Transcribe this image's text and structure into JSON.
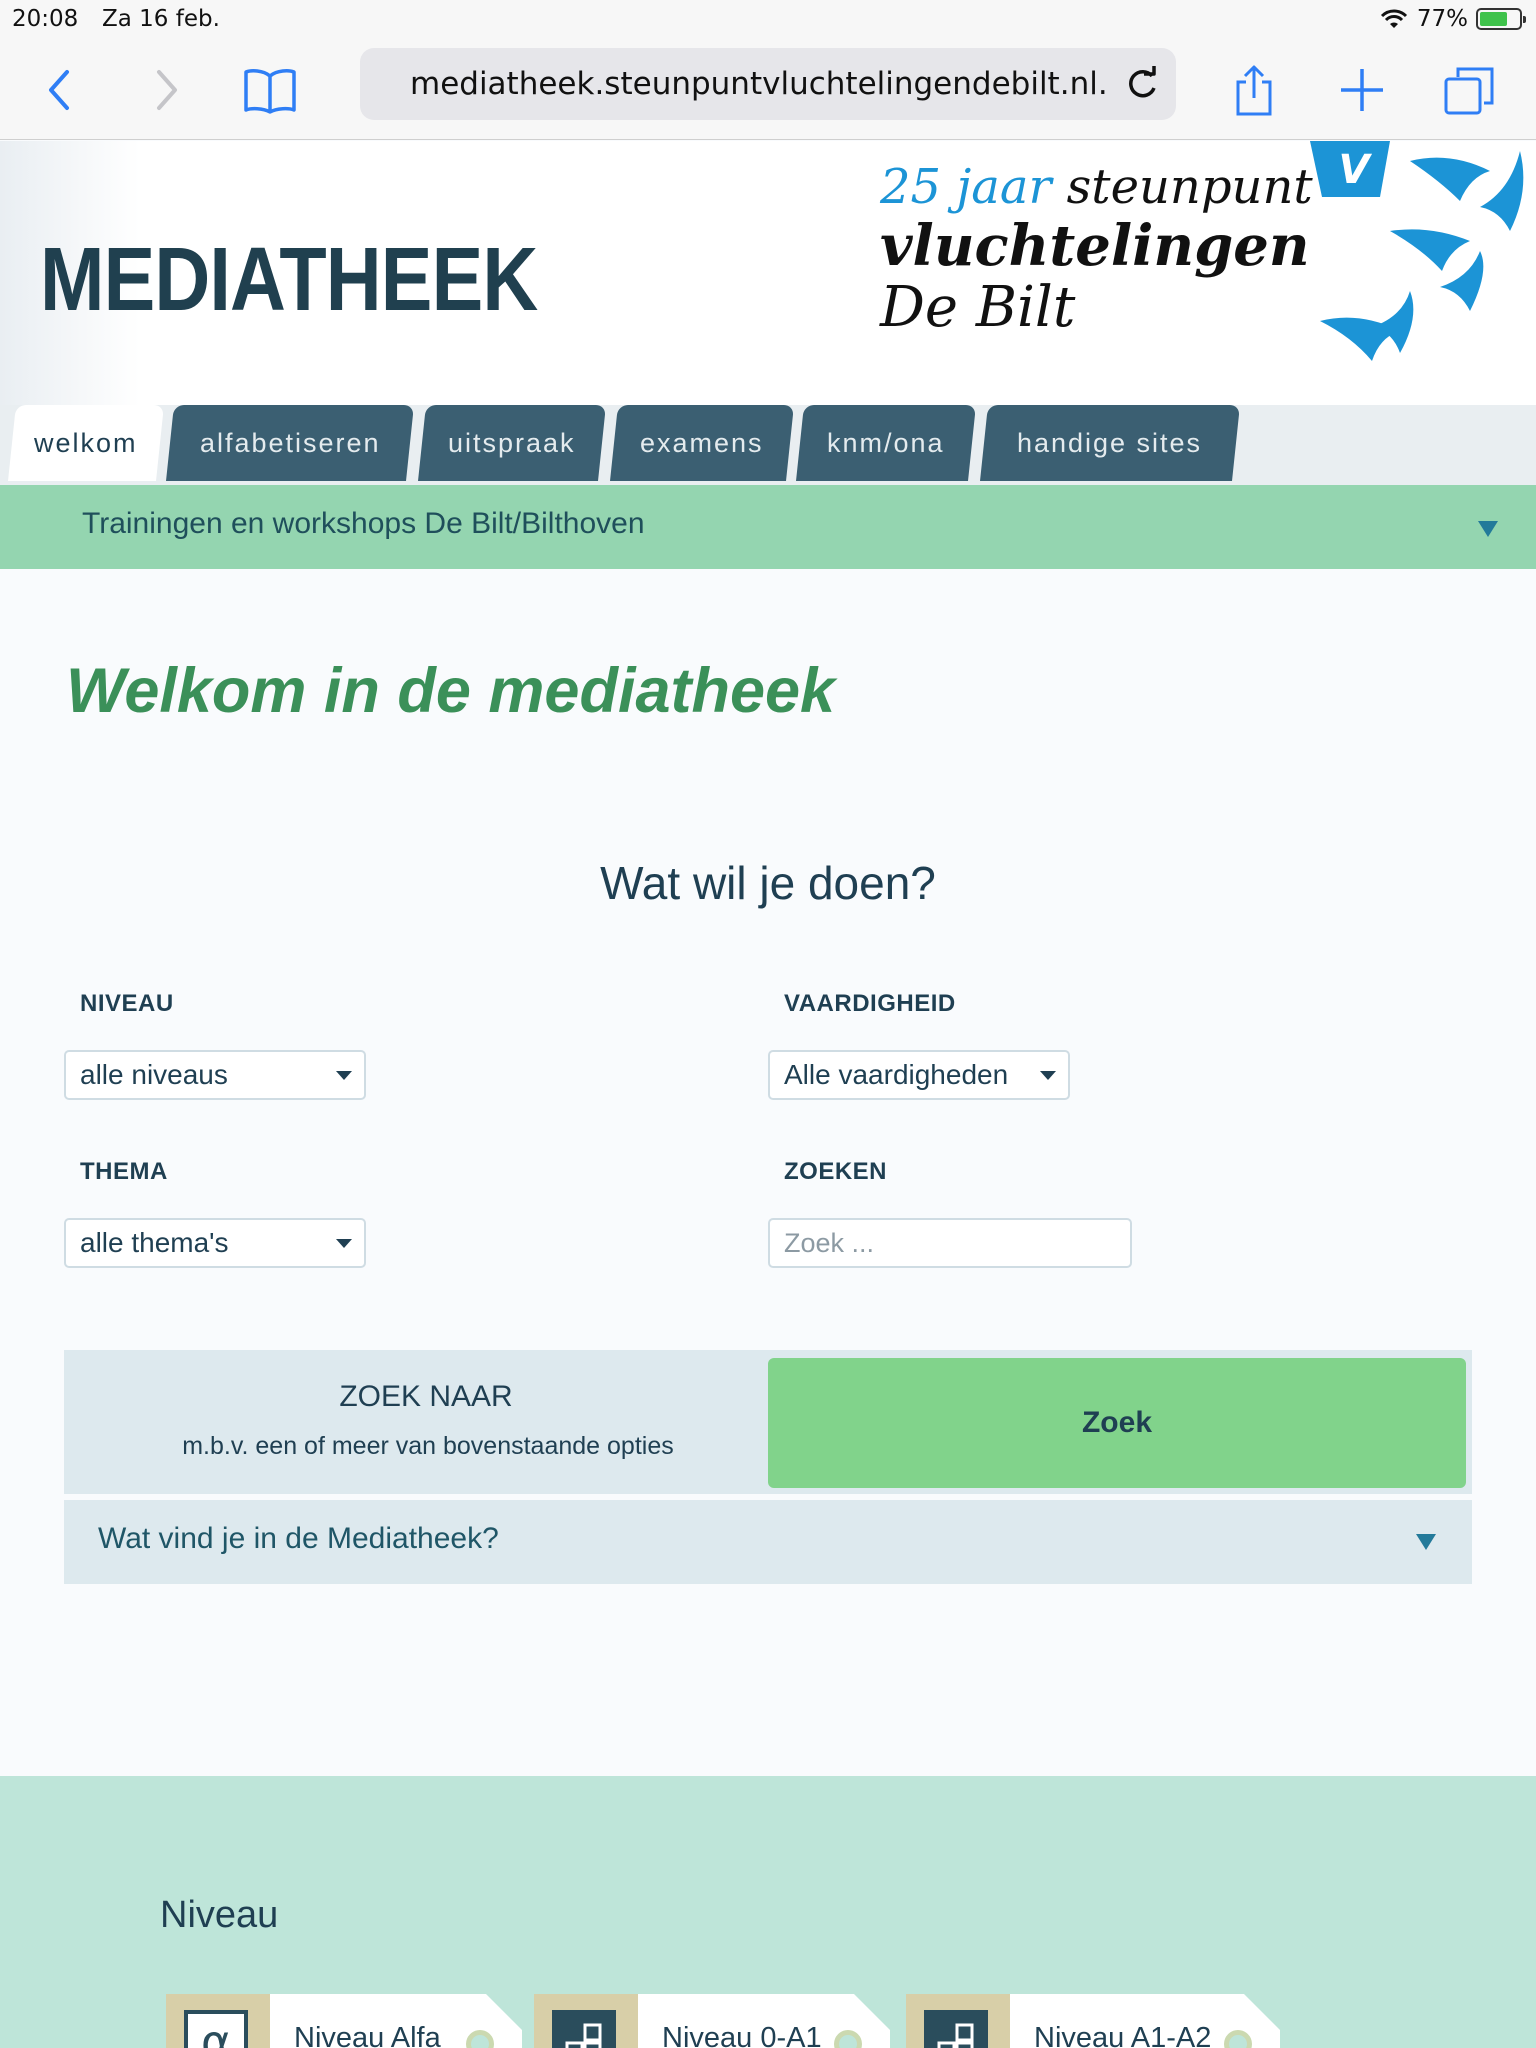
{
  "status_bar": {
    "time": "20:08",
    "date": "Za 16 feb.",
    "battery": "77%"
  },
  "browser": {
    "url": "mediatheek.steunpuntvluchtelingendebilt.nl."
  },
  "header": {
    "title": "MEDIATHEEK",
    "jubileum_l1_blue": "25 jaar",
    "jubileum_l1_rest": " steunpunt",
    "jubileum_l2": "vluchtelingen",
    "jubileum_l3": "De Bilt",
    "logo_letter": "V"
  },
  "tabs": [
    {
      "label": "welkom",
      "active": true
    },
    {
      "label": "alfabetiseren"
    },
    {
      "label": "uitspraak"
    },
    {
      "label": "examens"
    },
    {
      "label": "knm/ona"
    },
    {
      "label": "handige sites"
    }
  ],
  "banner": {
    "text": "Trainingen en workshops De Bilt/Bilthoven"
  },
  "main": {
    "welcome": "Welkom in de mediatheek",
    "question": "Wat wil je doen?",
    "niveau_label": "NIVEAU",
    "niveau_value": "alle niveaus",
    "vaardigheid_label": "VAARDIGHEID",
    "vaardigheid_value": "Alle vaardigheden",
    "thema_label": "THEMA",
    "thema_value": "alle thema's",
    "zoeken_label": "ZOEKEN",
    "zoeken_placeholder": "Zoek ...",
    "search_title": "ZOEK NAAR",
    "search_sub": "m.b.v. een of meer van bovenstaande opties",
    "search_button": "Zoek",
    "info_toggle": "Wat vind je in de Mediatheek?"
  },
  "footer": {
    "title": "Niveau",
    "cards": [
      {
        "label": "Niveau Alfa",
        "icon": "alpha-icon",
        "glyph": "α"
      },
      {
        "label": "Niveau 0-A1",
        "icon": "blocks-icon"
      },
      {
        "label": "Niveau A1-A2",
        "icon": "blocks-icon"
      }
    ]
  },
  "colors": {
    "accent_green": "#81d38b",
    "banner": "#94d5b0",
    "tab": "#3b5f72",
    "heading_green": "#3b9059",
    "ios_blue": "#2f7ef5"
  }
}
